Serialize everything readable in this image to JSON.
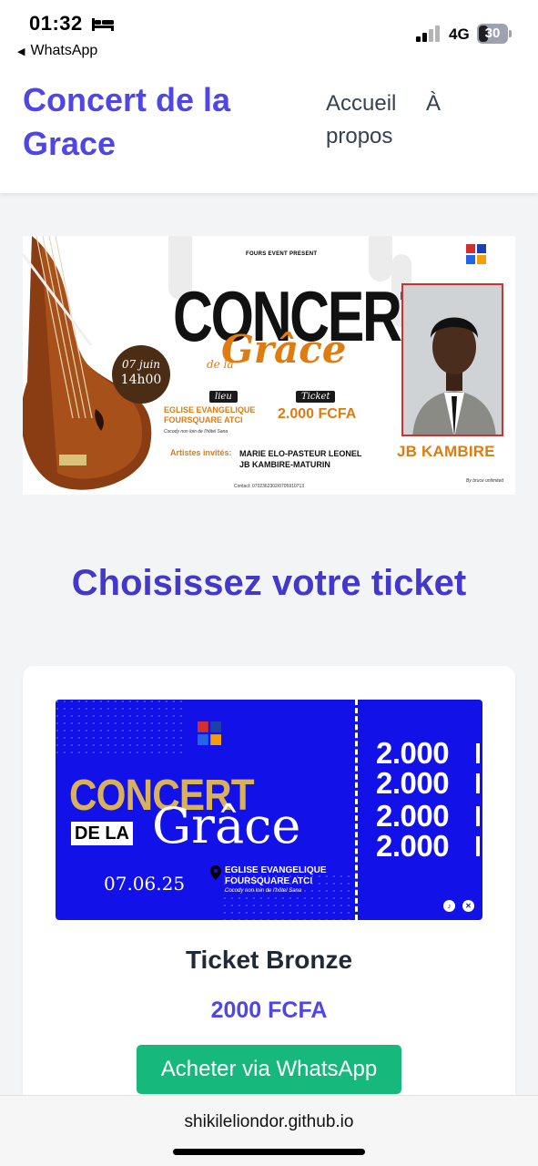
{
  "status_bar": {
    "time": "01:32",
    "back_app": "WhatsApp",
    "network": "4G",
    "battery": "30"
  },
  "header": {
    "brand": "Concert de la Grace",
    "nav": {
      "home": "Accueil",
      "about": "À propos"
    }
  },
  "banner": {
    "presenter": "FOURS EVENT PRESENT",
    "title_main": "CONCERT",
    "title_script": "Grâce",
    "title_small": "de la",
    "date": "07 juin",
    "time": "14h00",
    "venue_label": "lieu",
    "venue": "EGLISE EVANGELIQUE FOURSQUARE ATCI",
    "venue_detail": "Cocody non loin de l'hôtel Sana",
    "ticket_label": "Ticket",
    "ticket_price": "2.000 FCFA",
    "artists_label": "Artistes invités:",
    "artists_line1": "MARIE ELO-PASTEUR LEONEL",
    "artists_line2": "JB KAMBIRE-MATURIN",
    "contact": "Contact: 0702362302/0705910713",
    "credit": "By bruce unlimited",
    "artist_name": "JB KAMBIRE"
  },
  "section": {
    "title": "Choisissez votre ticket"
  },
  "ticket": {
    "image": {
      "title_main": "CONCERT",
      "title_dela": "DE LA",
      "title_script": "Grâce",
      "date": "07.06.25",
      "venue": "EGLISE EVANGELIQUE FOURSQUARE ATCI",
      "venue_detail": "Cocody non loin de l'hôtel Sana",
      "prices": [
        "2.000",
        "2.000",
        "2.000",
        "2.000"
      ]
    },
    "name": "Ticket Bronze",
    "price": "2000 FCFA",
    "buy_label": "Acheter via WhatsApp"
  },
  "browser": {
    "url": "shikileliondor.github.io"
  },
  "colors": {
    "brand": "#4f46e5",
    "section_title": "#4338ca",
    "whatsapp_button": "#16b87c",
    "ticket_blue": "#1212e8",
    "poster_orange": "#e07b0f"
  }
}
